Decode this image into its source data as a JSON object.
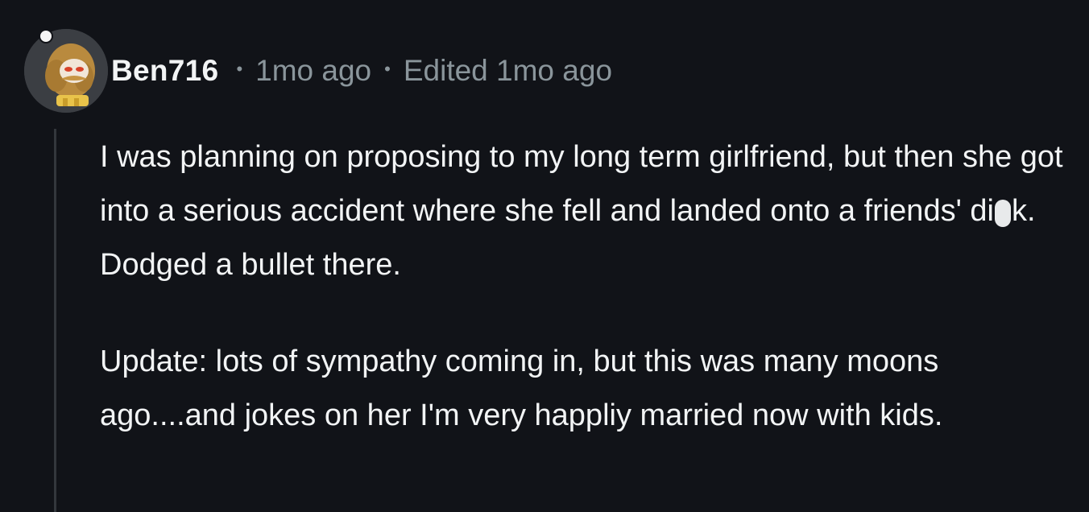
{
  "comment": {
    "username": "Ben716",
    "separator": "•",
    "posted": "1mo ago",
    "edited": "Edited 1mo ago",
    "avatar": "reddit-snoo-avatar-icon",
    "paragraph1_before": "I was planning on proposing to my long term girlfriend, but then she got into a serious accident where she fell and landed onto a friends' di",
    "paragraph1_after": "k. Dodged a bullet there.",
    "paragraph2": "Update: lots of sympathy coming in, but this was many moons ago....and jokes on her I'm very happliy married now with kids."
  },
  "colors": {
    "background": "#111318",
    "text": "#f2f4f5",
    "meta": "#8a959b",
    "thread_line": "#33373c"
  }
}
